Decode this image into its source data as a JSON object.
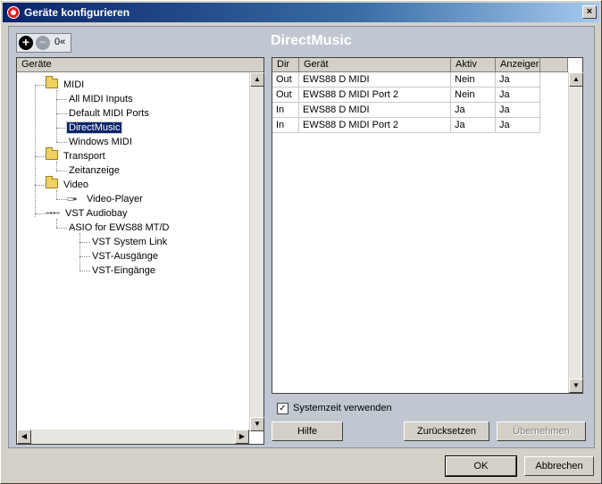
{
  "window": {
    "title": "Geräte konfigurieren",
    "close_label": "×"
  },
  "toolbar": {
    "add_label": "+",
    "remove_label": "−",
    "reset_label": "0«"
  },
  "section": {
    "title": "DirectMusic"
  },
  "tree": {
    "header": "Geräte",
    "items": [
      {
        "label": "MIDI",
        "icon": "folder-icon"
      },
      {
        "label": "All MIDI Inputs"
      },
      {
        "label": "Default MIDI Ports"
      },
      {
        "label": "DirectMusic"
      },
      {
        "label": "Windows MIDI"
      },
      {
        "label": "Transport",
        "icon": "folder-icon"
      },
      {
        "label": "Zeitanzeige"
      },
      {
        "label": "Video",
        "icon": "folder-icon"
      },
      {
        "label": "Video-Player",
        "icon": "video-icon"
      },
      {
        "label": "VST Audiobay",
        "icon": "audiobay-icon"
      },
      {
        "label": "ASIO for EWS88 MT/D"
      },
      {
        "label": "VST System Link"
      },
      {
        "label": "VST-Ausgänge"
      },
      {
        "label": "VST-Eingänge"
      }
    ],
    "selected": "DirectMusic"
  },
  "ports_table": {
    "columns": [
      "Dir",
      "Gerät",
      "Aktiv",
      "Anzeiger"
    ],
    "rows": [
      [
        "Out",
        "EWS88 D MIDI",
        "Nein",
        "Ja"
      ],
      [
        "Out",
        "EWS88 D MIDI Port 2",
        "Nein",
        "Ja"
      ],
      [
        "In",
        "EWS88 D MIDI",
        "Ja",
        "Ja"
      ],
      [
        "In",
        "EWS88 D MIDI Port 2",
        "Ja",
        "Ja"
      ]
    ]
  },
  "options": {
    "system_time_label": "Systemzeit verwenden",
    "system_time_checked": true,
    "check_mark": "✓"
  },
  "buttons": {
    "help": "Hilfe",
    "reset": "Zurücksetzen",
    "apply": "Übernehmen",
    "ok": "OK",
    "cancel": "Abbrechen"
  },
  "colors": {
    "title_bar": "#0a246a",
    "selection": "#0a246a",
    "panel_bg": "#c0c7d0"
  }
}
